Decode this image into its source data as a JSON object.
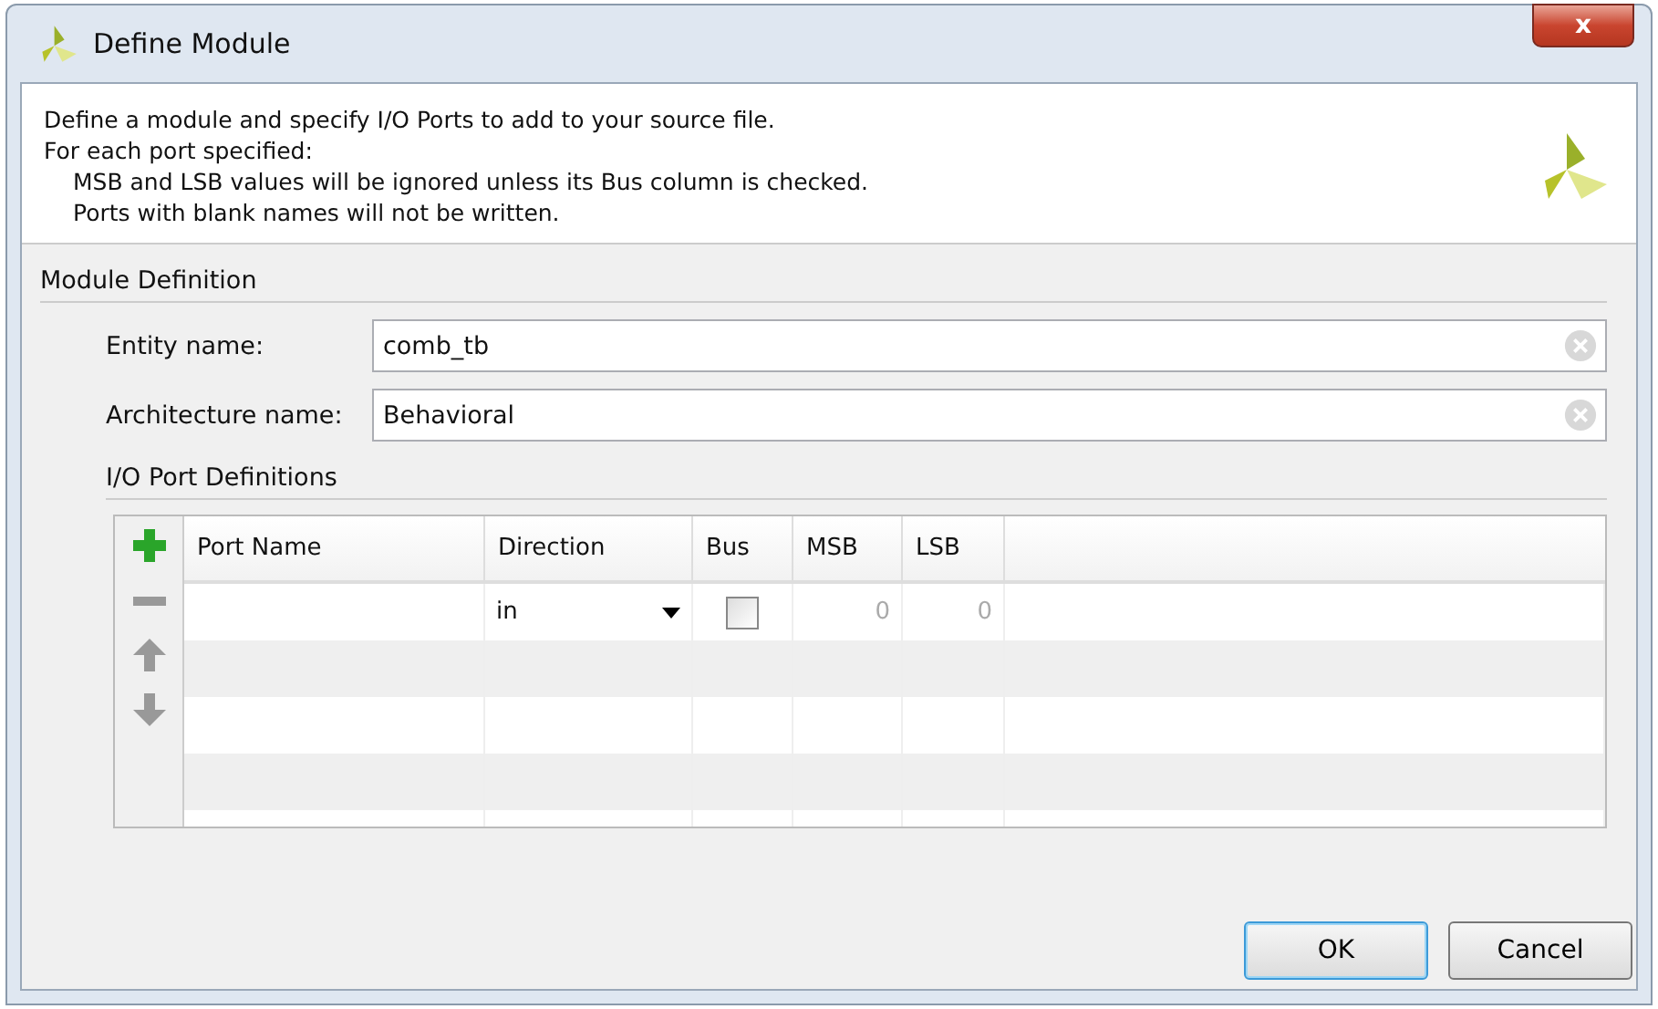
{
  "window": {
    "title": "Define Module",
    "close": "x"
  },
  "description": {
    "lines": [
      "Define a module and specify I/O Ports to add to your source file.",
      "For each port specified:"
    ],
    "notes": [
      "MSB and LSB values will be ignored unless its Bus column is checked.",
      "Ports with blank names will not be written."
    ]
  },
  "module_definition": {
    "title": "Module Definition",
    "fields": [
      {
        "label": "Entity name:",
        "value": "comb_tb"
      },
      {
        "label": "Architecture name:",
        "value": "Behavioral"
      }
    ]
  },
  "ports": {
    "title": "I/O Port Definitions",
    "columns": [
      "Port Name",
      "Direction",
      "Bus",
      "MSB",
      "LSB"
    ],
    "rows": [
      {
        "direction": "in",
        "bus": false,
        "msb": "0",
        "lsb": "0"
      }
    ],
    "tools": [
      {
        "kind": "add",
        "disabled": false
      },
      {
        "kind": "remove",
        "disabled": true
      },
      {
        "kind": "up",
        "disabled": true
      },
      {
        "kind": "down",
        "disabled": true
      }
    ]
  },
  "buttons": [
    {
      "label": "OK",
      "default": true
    },
    {
      "label": "Cancel",
      "default": false
    }
  ]
}
